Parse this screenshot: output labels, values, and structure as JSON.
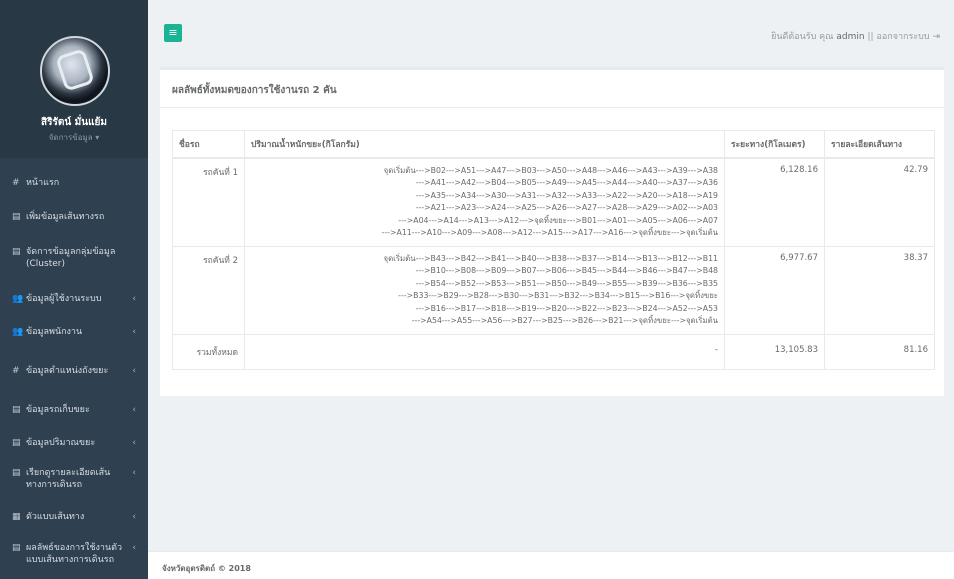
{
  "sidebar": {
    "profile_name": "สิริรัตน์ มั่นแย้ม",
    "profile_role": "จัดการข้อมูล ▾",
    "items": [
      {
        "icon": "home-icon",
        "glyph": "#",
        "label": "หน้าแรก",
        "chevron": ""
      },
      {
        "icon": "list-icon",
        "glyph": "▤",
        "label": "เพิ่มข้อมูลเส้นทางรถ",
        "chevron": ""
      },
      {
        "icon": "list-icon",
        "glyph": "▤",
        "label": "จัดการข้อมูลกลุ่มข้อมูล (Cluster)",
        "chevron": ""
      },
      {
        "icon": "users-icon",
        "glyph": "👥",
        "label": "ข้อมูลผู้ใช้งานระบบ",
        "chevron": "‹"
      },
      {
        "icon": "users-icon",
        "glyph": "👥",
        "label": "ข้อมูลพนักงาน",
        "chevron": "‹"
      },
      {
        "icon": "home-icon",
        "glyph": "#",
        "label": "ข้อมูลตำแหน่งถังขยะ",
        "chevron": "‹"
      },
      {
        "icon": "list-icon",
        "glyph": "▤",
        "label": "ข้อมูลรถเก็บขยะ",
        "chevron": "‹"
      },
      {
        "icon": "list-icon",
        "glyph": "▤",
        "label": "ข้อมูลปริมาณขยะ",
        "chevron": "‹"
      },
      {
        "icon": "list-icon",
        "glyph": "▤",
        "label": "เรียกดูรายละเอียดเส้นทางการเดินรถ",
        "chevron": "‹"
      },
      {
        "icon": "map-icon",
        "glyph": "▦",
        "label": "ตัวแบบเส้นทาง",
        "chevron": "‹"
      },
      {
        "icon": "list-icon",
        "glyph": "▤",
        "label": "ผลลัพธ์ของการใช้งานตัวแบบเส้นทางการเดินรถ",
        "chevron": "‹"
      }
    ]
  },
  "topbar": {
    "menu_glyph": "≡",
    "welcome": "ยินดีต้อนรับ คุณ",
    "user": "admin",
    "separator": "||",
    "logout": "ออกจากระบบ",
    "logout_glyph": "⇥"
  },
  "card": {
    "title": "ผลลัพธ์ทั้งหมดของการใช้งานรถ 2 คัน",
    "headers": [
      "ชื่อรถ",
      "ปริมาณน้ำหนักขยะ(กิโลกรัม)",
      "ระยะทาง(กิโลเมตร)",
      "รายละเอียดเส้นทาง"
    ],
    "rows": [
      {
        "name": "รถคันที่ 1",
        "route_lines": [
          "จุดเริ่มต้น--->B02--->A51--->A47--->B03--->A50--->A48--->A46--->A43--->A39--->A38",
          "--->A41--->A42--->B04--->B05--->A49--->A45--->A44--->A40--->A37--->A36",
          "--->A35--->A34--->A30--->A31--->A32--->A33--->A22--->A20--->A18--->A19",
          "--->A21--->A23--->A24--->A25--->A26--->A27--->A28--->A29--->A02--->A03",
          "--->A04--->A14--->A13--->A12--->จุดทิ้งขยะ--->B01--->A01--->A05--->A06--->A07",
          "--->A11--->A10--->A09--->A08--->A12--->A15--->A17--->A16--->จุดทิ้งขยะ--->จุดเริ่มต้น"
        ],
        "distance": "6,128.16",
        "detail": "42.79"
      },
      {
        "name": "รถคันที่ 2",
        "route_lines": [
          "จุดเริ่มต้น--->B43--->B42--->B41--->B40--->B38--->B37--->B14--->B13--->B12--->B11",
          "--->B10--->B08--->B09--->B07--->B06--->B45--->B44--->B46--->B47--->B48",
          "--->B54--->B52--->B53--->B51--->B50--->B49--->B55--->B39--->B36--->B35",
          "--->B33--->B29--->B28--->B30--->B31--->B32--->B34--->B15--->B16--->จุดทิ้งขยะ",
          "--->B16--->B17--->B18--->B19--->B20--->B22--->B23--->B24--->A52--->A53",
          "--->A54--->A55--->A56--->B27--->B25--->B26--->B21--->จุดทิ้งขยะ--->จุดเริ่มต้น"
        ],
        "distance": "6,977.67",
        "detail": "38.37"
      }
    ],
    "total": {
      "name": "รวมทั้งหมด",
      "route": "-",
      "distance": "13,105.83",
      "detail": "81.16"
    }
  },
  "footer": {
    "text": "จังหวัดอุตรดิตถ์ © 2018"
  }
}
